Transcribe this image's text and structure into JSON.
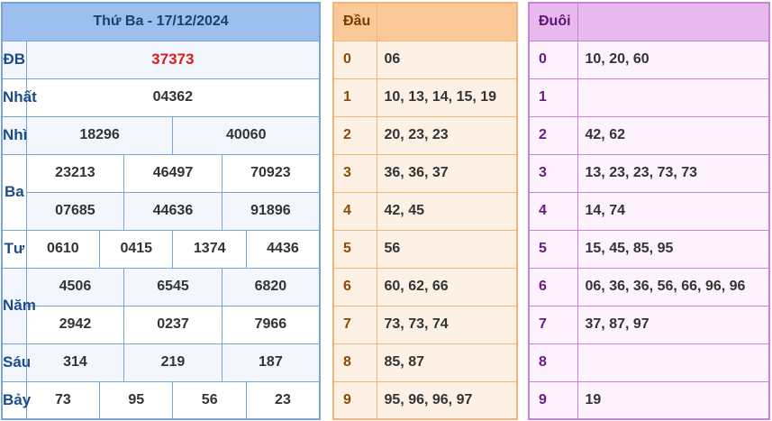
{
  "results": {
    "title": "Thứ Ba - 17/12/2024",
    "rows": {
      "db": {
        "label": "ĐB",
        "values": [
          "37373"
        ]
      },
      "nhat": {
        "label": "Nhất",
        "values": [
          "04362"
        ]
      },
      "nhi": {
        "label": "Nhì",
        "values": [
          "18296",
          "40060"
        ]
      },
      "ba": {
        "label": "Ba",
        "values": [
          "23213",
          "46497",
          "70923",
          "07685",
          "44636",
          "91896"
        ]
      },
      "tu": {
        "label": "Tư",
        "values": [
          "0610",
          "0415",
          "1374",
          "4436"
        ]
      },
      "nam": {
        "label": "Năm",
        "values": [
          "4506",
          "6545",
          "6820",
          "2942",
          "0237",
          "7966"
        ]
      },
      "sau": {
        "label": "Sáu",
        "values": [
          "314",
          "219",
          "187"
        ]
      },
      "bay": {
        "label": "Bảy",
        "values": [
          "73",
          "95",
          "56",
          "23"
        ]
      }
    }
  },
  "dau": {
    "header": "Đầu",
    "rows": [
      {
        "k": "0",
        "v": "06"
      },
      {
        "k": "1",
        "v": "10, 13, 14, 15, 19"
      },
      {
        "k": "2",
        "v": "20, 23, 23"
      },
      {
        "k": "3",
        "v": "36, 36, 37"
      },
      {
        "k": "4",
        "v": "42, 45"
      },
      {
        "k": "5",
        "v": "56"
      },
      {
        "k": "6",
        "v": "60, 62, 66"
      },
      {
        "k": "7",
        "v": "73, 73, 74"
      },
      {
        "k": "8",
        "v": "85, 87"
      },
      {
        "k": "9",
        "v": "95, 96, 96, 97"
      }
    ]
  },
  "duoi": {
    "header": "Đuôi",
    "rows": [
      {
        "k": "0",
        "v": "10, 20, 60"
      },
      {
        "k": "1",
        "v": ""
      },
      {
        "k": "2",
        "v": "42, 62"
      },
      {
        "k": "3",
        "v": "13, 23, 23, 73, 73"
      },
      {
        "k": "4",
        "v": "14, 74"
      },
      {
        "k": "5",
        "v": "15, 45, 85, 95"
      },
      {
        "k": "6",
        "v": "06, 36, 36, 56, 66, 96, 96"
      },
      {
        "k": "7",
        "v": "37, 87, 97"
      },
      {
        "k": "8",
        "v": ""
      },
      {
        "k": "9",
        "v": "19"
      }
    ]
  },
  "colors": {
    "special_prize": "#e11919",
    "results_header": "#9dbff0",
    "dau_header": "#fbc999",
    "duoi_header": "#e9b8ef"
  }
}
